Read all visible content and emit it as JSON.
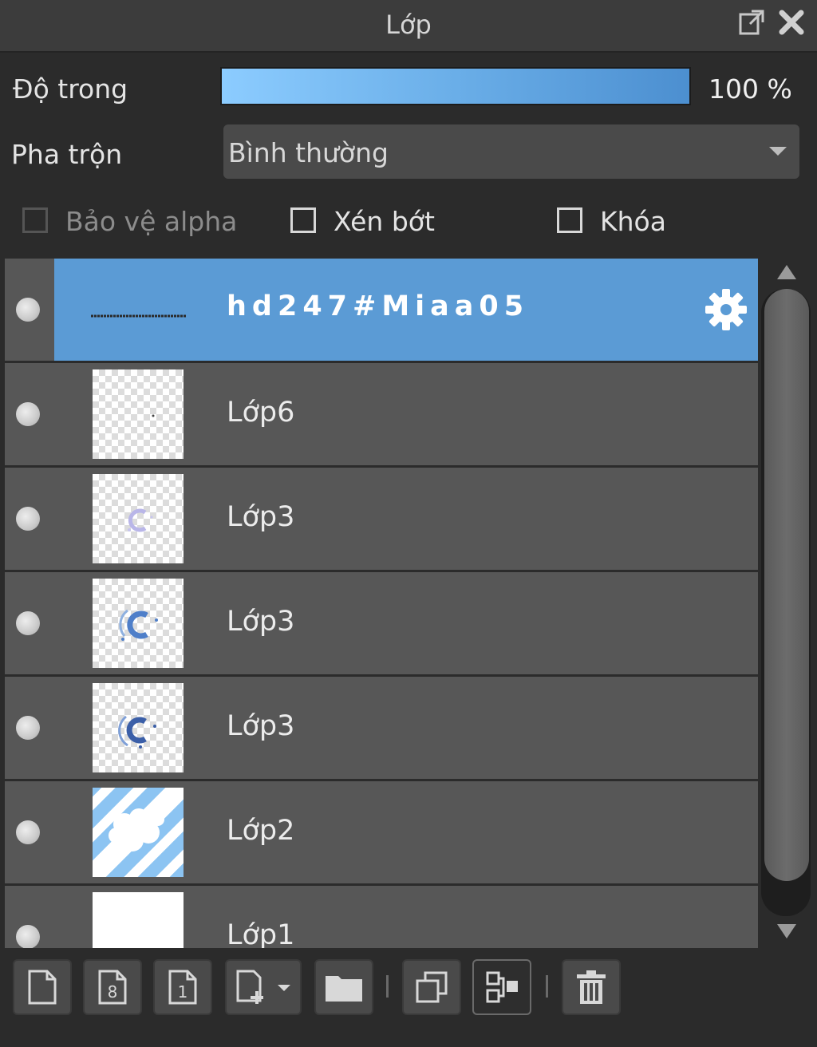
{
  "panel": {
    "title": "Lớp"
  },
  "opacity": {
    "label": "Độ trong",
    "value_text": "100 %",
    "value": 100
  },
  "blend": {
    "label": "Pha trộn",
    "selected": "Bình thường"
  },
  "checkboxes": {
    "protect_alpha": "Bảo vệ alpha",
    "clipping": "Xén bớt",
    "lock": "Khóa"
  },
  "layers": [
    {
      "name": "hd247#Miaa05",
      "selected": true,
      "has_settings": true
    },
    {
      "name": "Lớp6"
    },
    {
      "name": "Lớp3"
    },
    {
      "name": "Lớp3"
    },
    {
      "name": "Lớp3"
    },
    {
      "name": "Lớp2"
    },
    {
      "name": "Lớp1"
    }
  ],
  "icons": {
    "popout": "external-window-icon",
    "close": "close-icon",
    "settings": "gear-icon",
    "toolbar": [
      "new-layer-icon",
      "new-8bit-layer-icon",
      "new-1bit-layer-icon",
      "add-layer-menu-icon",
      "new-folder-icon",
      "duplicate-layer-icon",
      "merge-down-icon",
      "delete-icon"
    ]
  },
  "colors": {
    "selected_row": "#5b9bd5",
    "row": "#575757",
    "background": "#2b2b2b"
  }
}
